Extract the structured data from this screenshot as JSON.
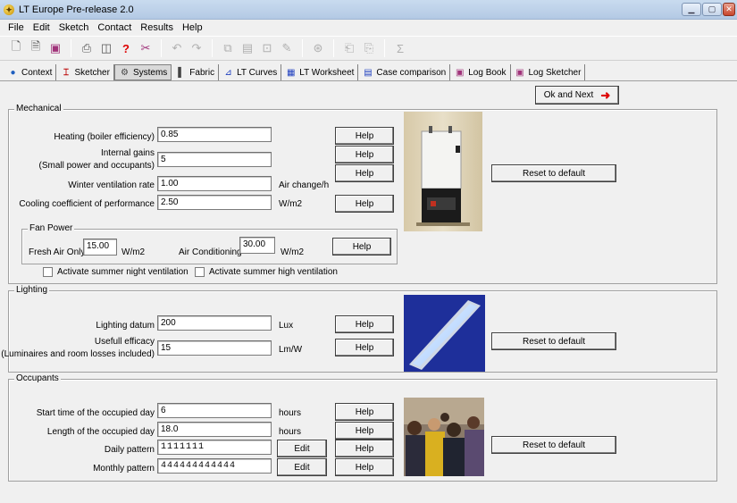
{
  "window": {
    "title": "LT Europe Pre-release 2.0",
    "app_icon": "lt-europe-icon"
  },
  "menu": [
    "File",
    "Edit",
    "Sketch",
    "Contact",
    "Results",
    "Help"
  ],
  "toolbar_icons": [
    "new-icon",
    "open-icon",
    "save-icon",
    "print-icon",
    "print-preview-icon",
    "help-icon",
    "tool-icon",
    "undo-icon",
    "redo-icon",
    "copy-icon",
    "paste-icon",
    "cut-icon",
    "edit-icon",
    "globe-icon",
    "export-icon",
    "import-icon",
    "sigma-icon"
  ],
  "tabs": [
    {
      "label": "Context",
      "icon": "globe-icon",
      "active": false
    },
    {
      "label": "Sketcher",
      "icon": "sketch-icon",
      "active": false
    },
    {
      "label": "Systems",
      "icon": "systems-icon",
      "active": true
    },
    {
      "label": "Fabric",
      "icon": "fabric-icon",
      "active": false
    },
    {
      "label": "LT Curves",
      "icon": "curves-icon",
      "active": false
    },
    {
      "label": "LT Worksheet",
      "icon": "worksheet-icon",
      "active": false
    },
    {
      "label": "Case comparison",
      "icon": "comparison-icon",
      "active": false
    },
    {
      "label": "Log Book",
      "icon": "logbook-icon",
      "active": false
    },
    {
      "label": "Log Sketcher",
      "icon": "logsketcher-icon",
      "active": false
    }
  ],
  "ok_next": {
    "label": "Ok and Next",
    "icon": "arrow-right-icon"
  },
  "mechanical": {
    "title": "Mechanical",
    "heating_label": "Heating (boiler efficiency)",
    "heating_value": "0.85",
    "gains_label_1": "Internal gains",
    "gains_label_2": "(Small power and occupants)",
    "gains_value": "5",
    "winter_label": "Winter ventilation rate",
    "winter_value": "1.00",
    "winter_unit": "Air change/h",
    "cooling_label": "Cooling coefficient of performance",
    "cooling_value": "2.50",
    "cooling_unit": "W/m2",
    "help": "Help",
    "reset": "Reset to default",
    "fan": {
      "title": "Fan Power",
      "fresh_label": "Fresh Air Only",
      "fresh_value": "15.00",
      "fresh_unit": "W/m2",
      "ac_label": "Air Conditioning",
      "ac_value": "30.00",
      "ac_unit": "W/m2"
    },
    "chk_night": "Activate summer night ventilation",
    "chk_high": "Activate summer high ventilation"
  },
  "lighting": {
    "title": "Lighting",
    "datum_label": "Lighting datum",
    "datum_value": "200",
    "datum_unit": "Lux",
    "efficacy_label_1": "Usefull efficacy",
    "efficacy_label_2": "(Luminaires and room losses included)",
    "efficacy_value": "15",
    "efficacy_unit": "Lm/W",
    "help": "Help",
    "reset": "Reset to default"
  },
  "occupants": {
    "title": "Occupants",
    "start_label": "Start time of the occupied day",
    "start_value": "6",
    "start_unit": "hours",
    "length_label": "Length of the occupied day",
    "length_value": "18.0",
    "length_unit": "hours",
    "daily_label": "Daily pattern",
    "daily_value": "1111111",
    "monthly_label": "Monthly pattern",
    "monthly_value": "444444444444",
    "edit": "Edit",
    "help": "Help",
    "reset": "Reset to default"
  }
}
